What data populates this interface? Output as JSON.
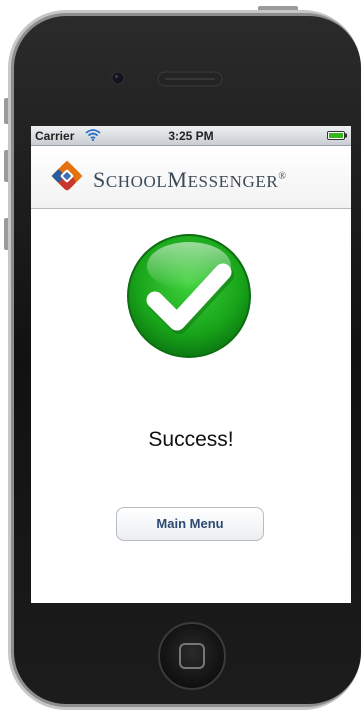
{
  "status_bar": {
    "carrier": "Carrier",
    "time": "3:25 PM",
    "icons": [
      "wifi-icon",
      "battery-icon"
    ]
  },
  "header": {
    "logo_icon": "school-messenger-logo-icon",
    "brand_first_cap": "S",
    "brand_first_rest": "CHOOL",
    "brand_second_cap": "M",
    "brand_second_rest": "ESSENGER",
    "brand_mark": "®"
  },
  "main": {
    "status_icon": "check-icon",
    "message": "Success!",
    "button_label": "Main Menu"
  },
  "colors": {
    "success_green": "#1fae1f",
    "brand_text": "#3c4a57",
    "button_text": "#2e4a73"
  }
}
